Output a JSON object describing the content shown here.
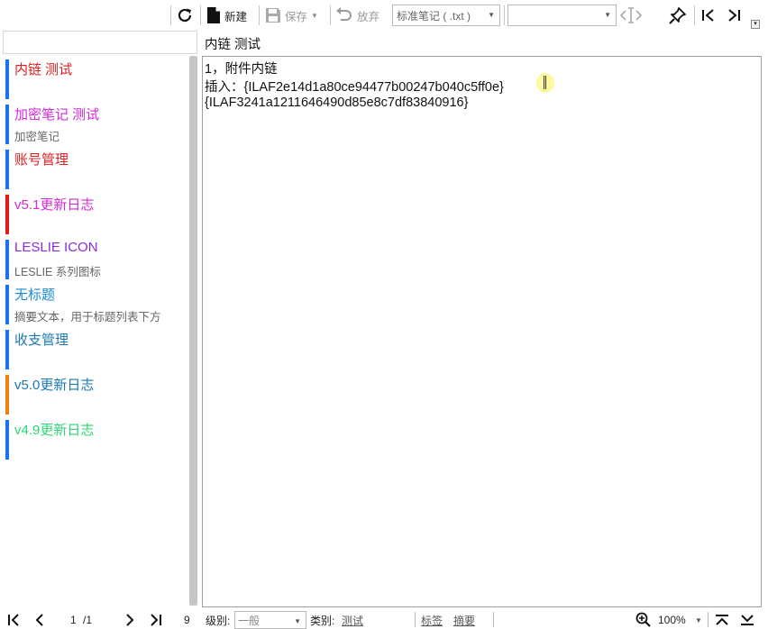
{
  "toolbar": {
    "new_label": "新建",
    "save_label": "保存",
    "discard_label": "放弃",
    "format_value": "标准笔记 ( .txt )",
    "secondary_combo_value": ""
  },
  "sidebar": {
    "search_placeholder": "",
    "notes": [
      {
        "title": "内链 测试",
        "subtitle": "",
        "title_color": "#e02020",
        "bar_color": "#1a73e8"
      },
      {
        "title": "加密笔记 测试",
        "subtitle": "加密笔记",
        "title_color": "#d32ad8",
        "bar_color": "#1a73e8"
      },
      {
        "title": "账号管理",
        "subtitle": "",
        "title_color": "#e02020",
        "bar_color": "#1a73e8"
      },
      {
        "title": "v5.1更新日志",
        "subtitle": "",
        "title_color": "#d32ad8",
        "bar_color": "#e41b1b"
      },
      {
        "title": "LESLIE ICON",
        "subtitle": "LESLIE 系列图标",
        "title_color": "#8a2be2",
        "bar_color": "#1a73e8"
      },
      {
        "title": "无标题",
        "subtitle": "摘要文本，用于标题列表下方",
        "title_color": "#1a8ad0",
        "bar_color": "#1a73e8"
      },
      {
        "title": "收支管理",
        "subtitle": "",
        "title_color": "#1a78b4",
        "bar_color": "#1a73e8"
      },
      {
        "title": "v5.0更新日志",
        "subtitle": "",
        "title_color": "#1a78b4",
        "bar_color": "#f07f10"
      },
      {
        "title": "v4.9更新日志",
        "subtitle": "",
        "title_color": "#2dd673",
        "bar_color": "#1a73e8"
      }
    ]
  },
  "editor": {
    "title": "内链 测试",
    "lines": [
      "1，附件内链",
      "插入：{ILAF2e14d1a80ce94477b00247b040c5ff0e}",
      "{ILAF3241a1211646490d85e8c7df83840916}"
    ]
  },
  "statusbar": {
    "page_current": "1",
    "page_total": "/1",
    "count": "9",
    "level_label": "级别:",
    "level_value": "一般",
    "category_label": "类别:",
    "category_value": "测试",
    "tags_label": "标签",
    "summary_label": "摘要",
    "zoom": "100%"
  },
  "icons": {
    "refresh": "refresh-icon",
    "new": "new-document-icon",
    "save": "save-icon",
    "undo": "undo-icon",
    "pin": "pin-icon"
  }
}
